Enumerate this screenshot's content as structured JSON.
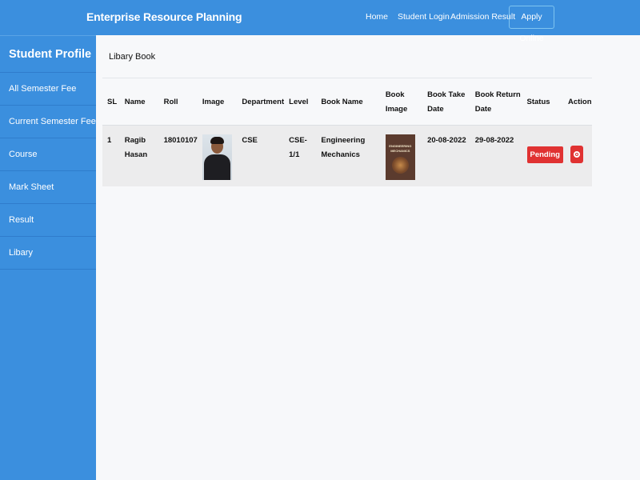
{
  "navbar": {
    "brand": "Enterprise Resource Planning",
    "links": [
      "Home",
      "Student Login",
      "Admission Result"
    ],
    "apply": "Apply Online"
  },
  "sidebar": {
    "title": "Student Profile",
    "items": [
      {
        "label": "All Semester Fee"
      },
      {
        "label": "Current Semester Fee"
      },
      {
        "label": "Course"
      },
      {
        "label": "Mark Sheet"
      },
      {
        "label": "Result"
      },
      {
        "label": "Libary"
      }
    ]
  },
  "main": {
    "title": "Libary Book",
    "columns": [
      "SL",
      "Name",
      "Roll",
      "Image",
      "Department",
      "Level",
      "Book Name",
      "Book Image",
      "Book Take Date",
      "Book Return Date",
      "Status",
      "Action"
    ],
    "rows": [
      {
        "sl": "1",
        "name": "Ragib Hasan",
        "roll": "18010107",
        "department": "CSE",
        "level": "CSE-1/1",
        "book_name": "Engineering Mechanics",
        "book_cover_text": "ENGINEERING MECHANICS",
        "take_date": "20-08-2022",
        "return_date": "29-08-2022",
        "status": "Pending"
      }
    ]
  },
  "colors": {
    "primary": "#3b8fde",
    "danger": "#e03232",
    "row_bg": "#ececed"
  }
}
